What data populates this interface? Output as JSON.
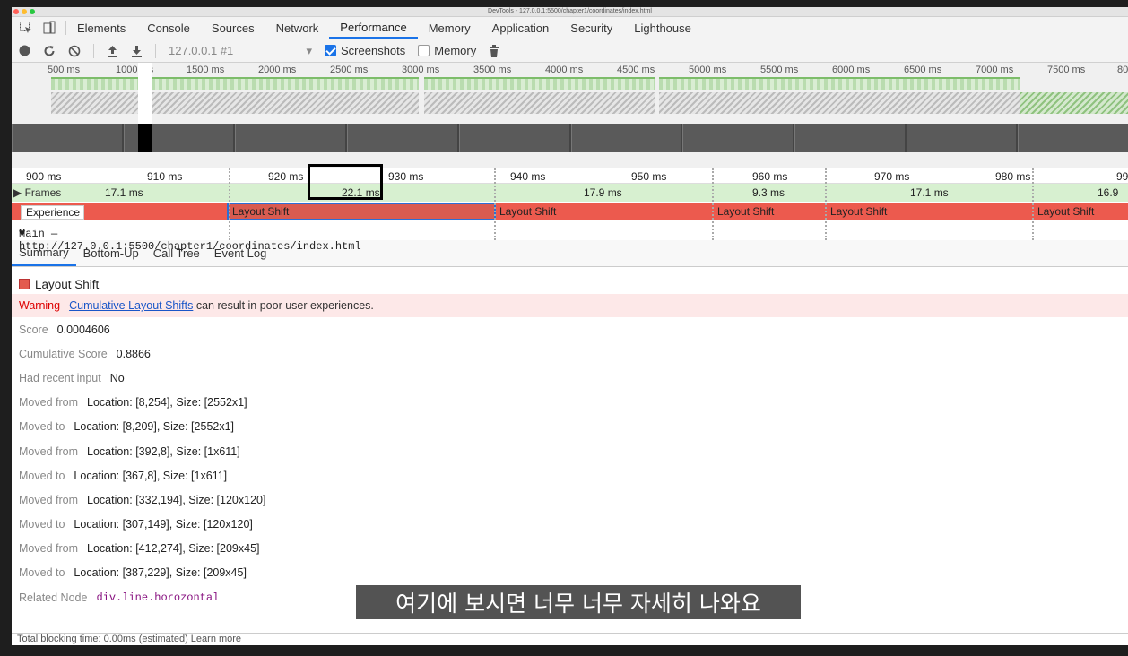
{
  "window": {
    "title": "DevTools - 127.0.0.1:5500/chapter1/coordinates/index.html"
  },
  "tabs": [
    "Elements",
    "Console",
    "Sources",
    "Network",
    "Performance",
    "Memory",
    "Application",
    "Security",
    "Lighthouse"
  ],
  "active_tab": "Performance",
  "toolbar": {
    "target": "127.0.0.1 #1",
    "screenshots_label": "Screenshots",
    "screenshots_checked": true,
    "memory_label": "Memory",
    "memory_checked": false
  },
  "overview_ruler": [
    "500 ms",
    "1000 ms",
    "1500 ms",
    "2000 ms",
    "2500 ms",
    "3000 ms",
    "3500 ms",
    "4000 ms",
    "4500 ms",
    "5000 ms",
    "5500 ms",
    "6000 ms",
    "6500 ms",
    "7000 ms",
    "7500 ms",
    "80"
  ],
  "timeline_ruler": [
    "900 ms",
    "910 ms",
    "920 ms",
    "930 ms",
    "940 ms",
    "950 ms",
    "960 ms",
    "970 ms",
    "980 ms",
    "99"
  ],
  "frames": {
    "label": "Frames",
    "values": [
      "17.1 ms",
      "22.1 ms",
      "17.9 ms",
      "9.3 ms",
      "17.1 ms",
      "16.9"
    ]
  },
  "experience": {
    "label": "Experience",
    "shifts": [
      "Layout Shift",
      "Layout Shift",
      "Layout Shift",
      "Layout Shift",
      "Layout Shift"
    ]
  },
  "main_thread": {
    "label": "Main — http://127.0.0.1:5500/chapter1/coordinates/index.html"
  },
  "bottom_tabs": [
    "Summary",
    "Bottom-Up",
    "Call Tree",
    "Event Log"
  ],
  "summary": {
    "title": "Layout Shift",
    "warning_label": "Warning",
    "warning_link": "Cumulative Layout Shifts",
    "warning_text": "can result in poor user experiences.",
    "rows": [
      {
        "key": "Score",
        "value": "0.0004606"
      },
      {
        "key": "Cumulative Score",
        "value": "0.8866"
      },
      {
        "key": "Had recent input",
        "value": "No"
      },
      {
        "key": "Moved from",
        "value": "Location: [8,254], Size: [2552x1]"
      },
      {
        "key": "Moved to",
        "value": "Location: [8,209], Size: [2552x1]"
      },
      {
        "key": "Moved from",
        "value": "Location: [392,8], Size: [1x611]"
      },
      {
        "key": "Moved to",
        "value": "Location: [367,8], Size: [1x611]"
      },
      {
        "key": "Moved from",
        "value": "Location: [332,194], Size: [120x120]"
      },
      {
        "key": "Moved to",
        "value": "Location: [307,149], Size: [120x120]"
      },
      {
        "key": "Moved from",
        "value": "Location: [412,274], Size: [209x45]"
      },
      {
        "key": "Moved to",
        "value": "Location: [387,229], Size: [209x45]"
      }
    ],
    "related_node_label": "Related Node",
    "related_node_value": "div.line.horozontal"
  },
  "footer_text": "Total blocking time: 0.00ms (estimated) Learn more",
  "subtitle": "여기에 보시면 너무 너무 자세히 나와요",
  "colors": {
    "accent": "#1a73e8",
    "layout_shift": "#ec5a4e",
    "frames": "#d7f0d0",
    "warning_bg": "#fde8e8"
  }
}
